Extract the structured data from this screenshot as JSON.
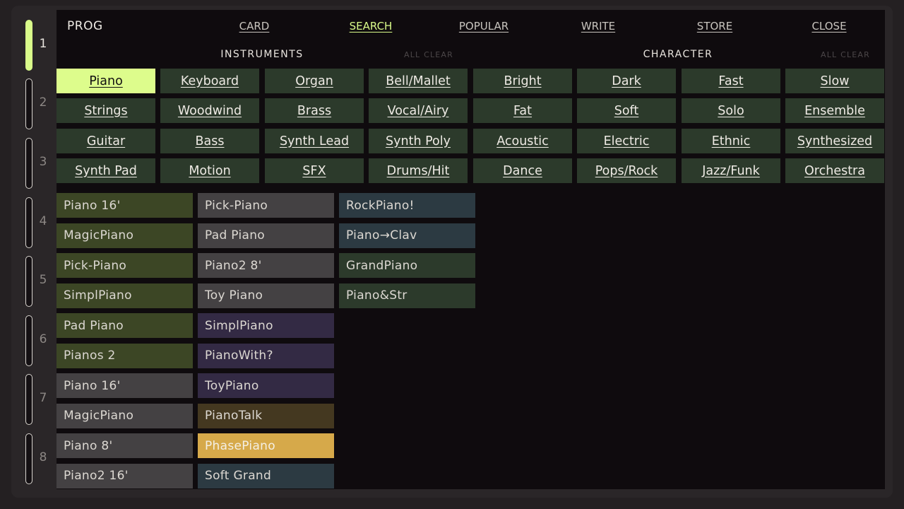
{
  "header": {
    "prog": "PROG",
    "nav": [
      {
        "label": "CARD"
      },
      {
        "label": "SEARCH"
      },
      {
        "label": "POPULAR"
      },
      {
        "label": "WRITE"
      },
      {
        "label": "STORE"
      },
      {
        "label": "CLOSE"
      }
    ],
    "active_nav": "SEARCH"
  },
  "parts": [
    "1",
    "2",
    "3",
    "4",
    "5",
    "6",
    "7",
    "8"
  ],
  "active_part": "1",
  "instruments": {
    "title": "INSTRUMENTS",
    "clear": "ALL CLEAR",
    "items": [
      "Piano",
      "Keyboard",
      "Organ",
      "Bell/Mallet",
      "Strings",
      "Woodwind",
      "Brass",
      "Vocal/Airy",
      "Guitar",
      "Bass",
      "Synth Lead",
      "Synth Poly",
      "Synth Pad",
      "Motion",
      "SFX",
      "Drums/Hit"
    ],
    "selected": "Piano"
  },
  "character": {
    "title": "CHARACTER",
    "clear": "ALL CLEAR",
    "items": [
      "Bright",
      "Dark",
      "Fast",
      "Slow",
      "Fat",
      "Soft",
      "Solo",
      "Ensemble",
      "Acoustic",
      "Electric",
      "Ethnic",
      "Synthesized",
      "Dance",
      "Pops/Rock",
      "Jazz/Funk",
      "Orchestra"
    ]
  },
  "results": [
    [
      {
        "name": "Piano 16'",
        "color": "olive"
      },
      {
        "name": "MagicPiano",
        "color": "olive"
      },
      {
        "name": "Pick-Piano",
        "color": "olive"
      },
      {
        "name": "SimplPiano",
        "color": "olive"
      },
      {
        "name": "Pad Piano",
        "color": "olive"
      },
      {
        "name": "Pianos 2",
        "color": "olive"
      },
      {
        "name": "Piano 16'",
        "color": "gray"
      },
      {
        "name": "MagicPiano",
        "color": "gray"
      },
      {
        "name": "Piano 8'",
        "color": "gray"
      },
      {
        "name": "Piano2 16'",
        "color": "gray"
      }
    ],
    [
      {
        "name": "Pick-Piano",
        "color": "gray"
      },
      {
        "name": "Pad Piano",
        "color": "gray"
      },
      {
        "name": "Piano2  8'",
        "color": "gray"
      },
      {
        "name": "Toy Piano",
        "color": "gray"
      },
      {
        "name": "SimplPiano",
        "color": "purple"
      },
      {
        "name": "PianoWith?",
        "color": "purple"
      },
      {
        "name": "ToyPiano",
        "color": "purple"
      },
      {
        "name": "PianoTalk",
        "color": "brown"
      },
      {
        "name": "PhasePiano",
        "color": "gold"
      },
      {
        "name": "Soft Grand",
        "color": "blue"
      }
    ],
    [
      {
        "name": "RockPiano!",
        "color": "blue"
      },
      {
        "name": "Piano→Clav",
        "color": "blue"
      },
      {
        "name": "GrandPiano",
        "color": "green"
      },
      {
        "name": "Piano&Str",
        "color": "green"
      }
    ]
  ]
}
